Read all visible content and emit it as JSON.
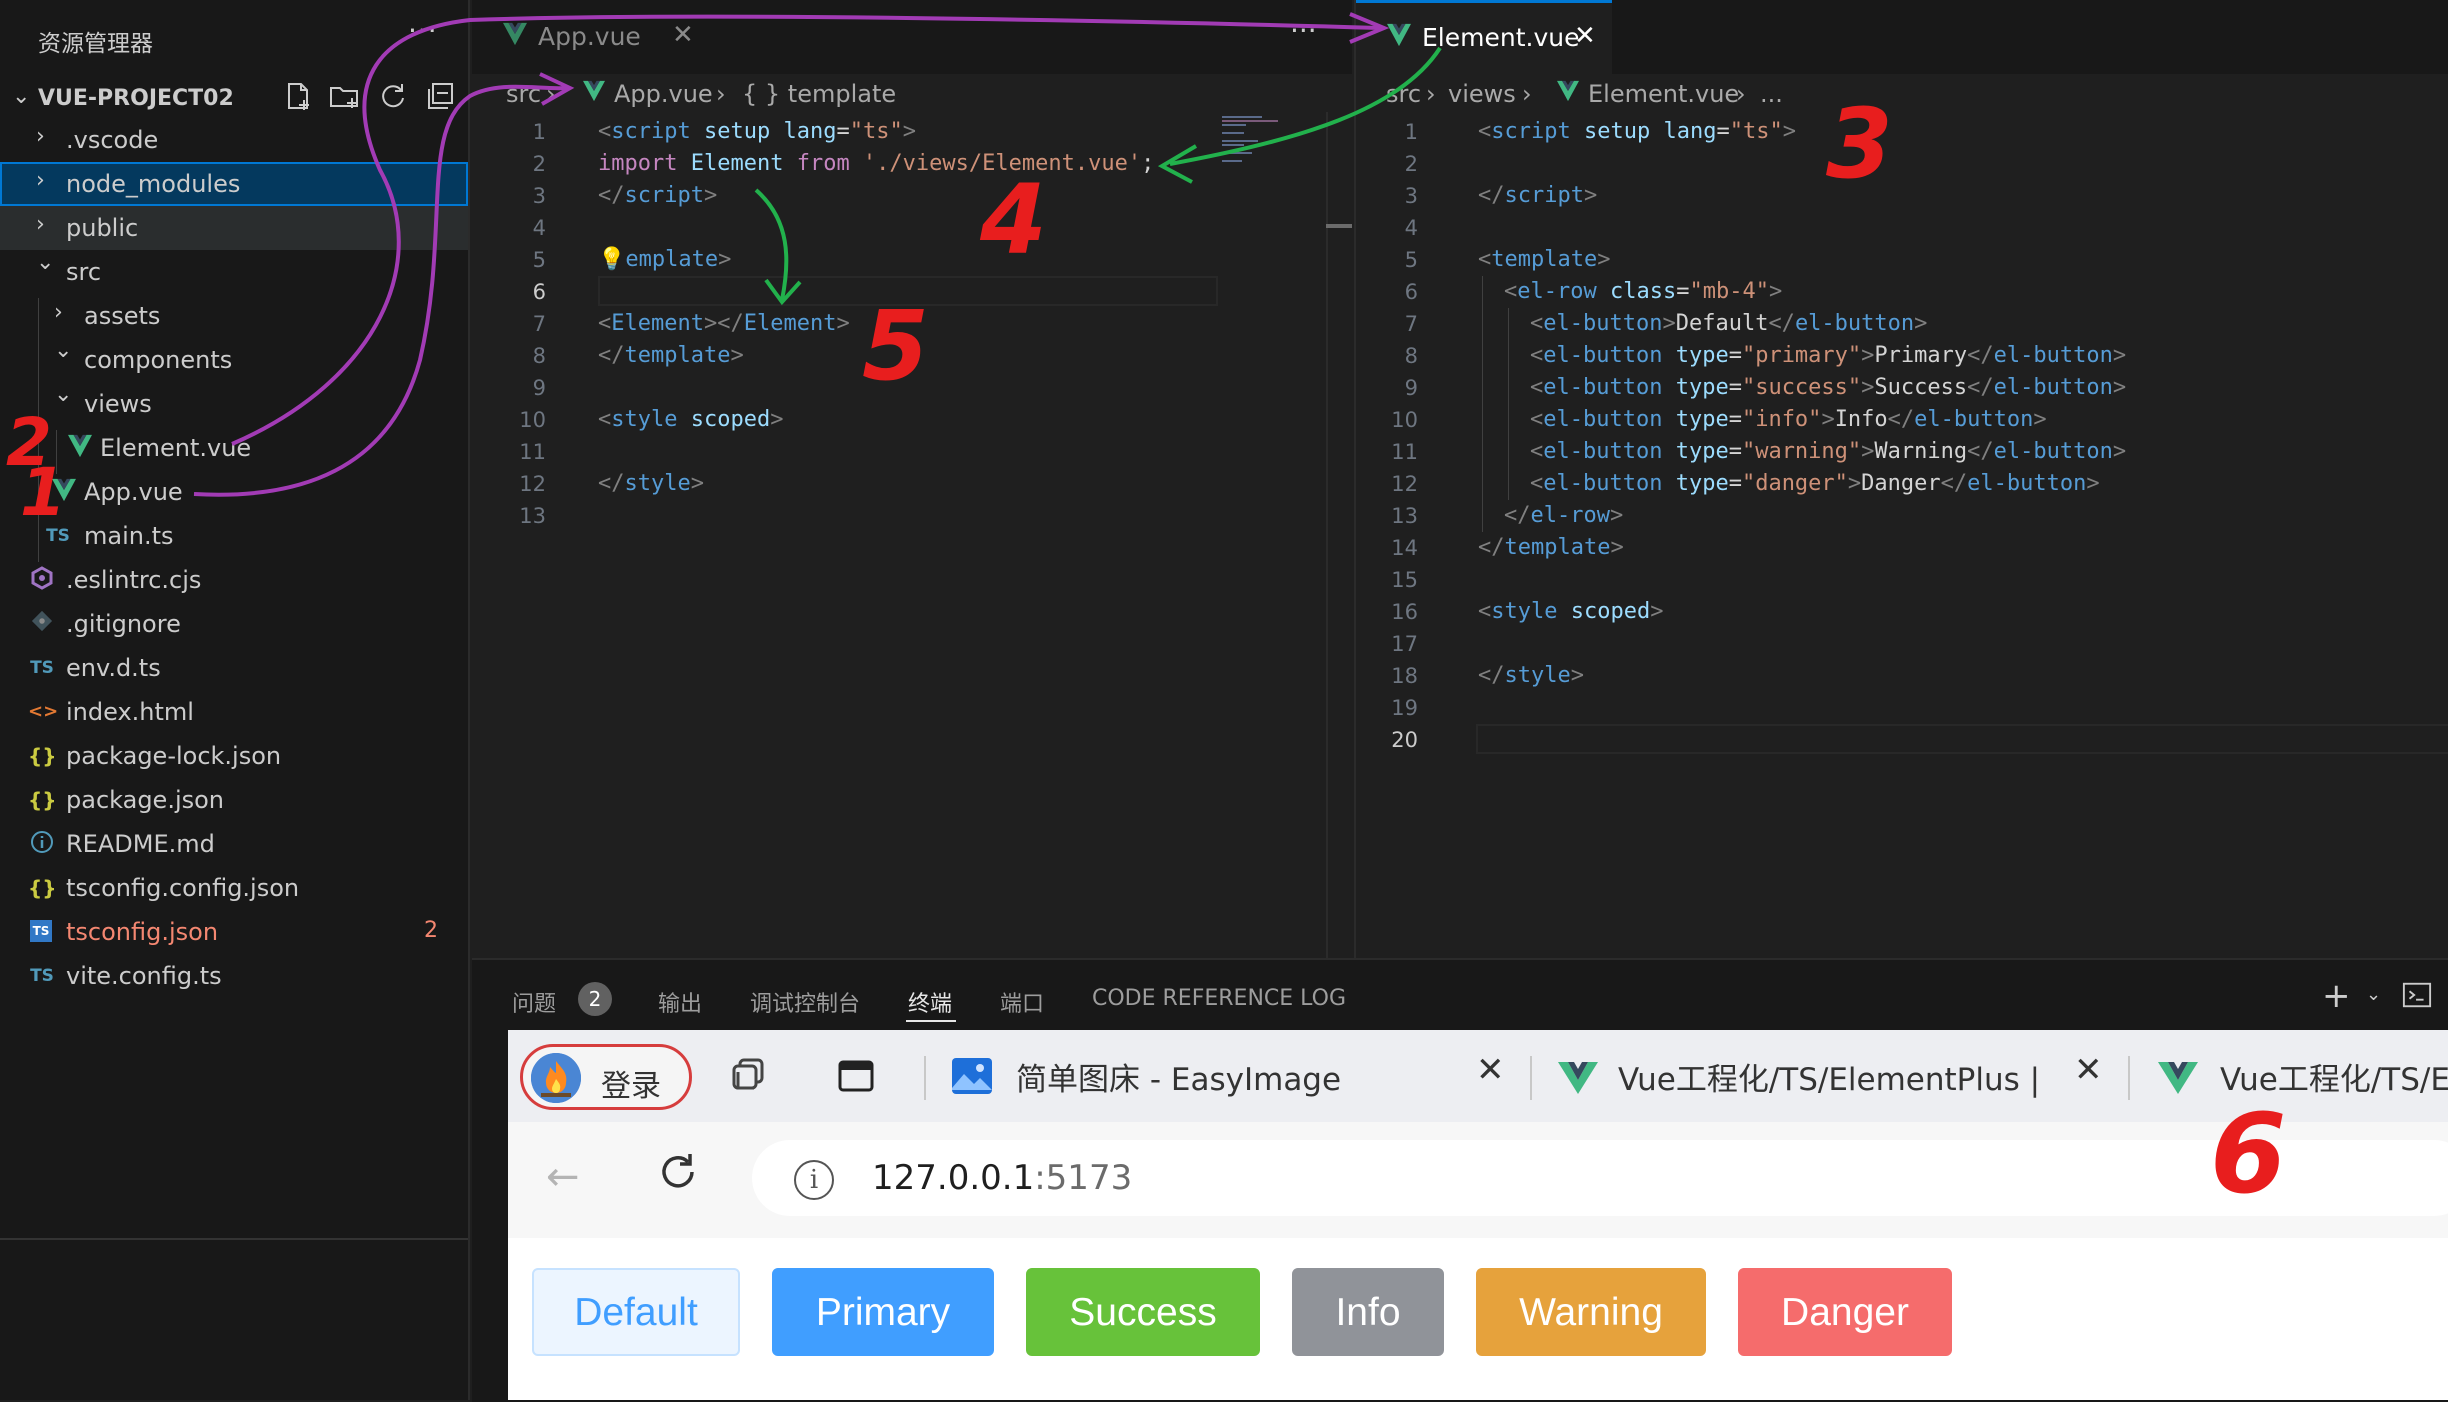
{
  "explorer": {
    "title": "资源管理器",
    "more": "···",
    "project_name": "VUE-PROJECT02",
    "items": [
      {
        "label": ".vscode",
        "icon": "",
        "chevron": "›",
        "error": false
      },
      {
        "label": "node_modules",
        "icon": "",
        "chevron": "›",
        "error": false
      },
      {
        "label": "public",
        "icon": "",
        "chevron": "›",
        "error": false
      },
      {
        "label": "src",
        "icon": "",
        "chevron": "⌄",
        "error": false
      },
      {
        "label": "assets",
        "icon": "",
        "chevron": "›",
        "error": false
      },
      {
        "label": "components",
        "icon": "",
        "chevron": "⌄",
        "error": false
      },
      {
        "label": "views",
        "icon": "",
        "chevron": "⌄",
        "error": false
      },
      {
        "label": "Element.vue",
        "icon": "vue-icon",
        "chevron": "",
        "error": false
      },
      {
        "label": "App.vue",
        "icon": "vue-icon",
        "chevron": "",
        "error": false
      },
      {
        "label": "main.ts",
        "icon": "TS",
        "chevron": "",
        "error": false
      },
      {
        "label": ".eslintrc.cjs",
        "icon": "eslint-icon",
        "chevron": "",
        "error": false
      },
      {
        "label": ".gitignore",
        "icon": "git-icon",
        "chevron": "",
        "error": false
      },
      {
        "label": "env.d.ts",
        "icon": "TS",
        "chevron": "",
        "error": false
      },
      {
        "label": "index.html",
        "icon": "<>",
        "chevron": "",
        "error": false
      },
      {
        "label": "package-lock.json",
        "icon": "{}",
        "chevron": "",
        "error": false
      },
      {
        "label": "package.json",
        "icon": "{}",
        "chevron": "",
        "error": false
      },
      {
        "label": "README.md",
        "icon": "info-icon",
        "chevron": "",
        "error": false
      },
      {
        "label": "tsconfig.config.json",
        "icon": "{}",
        "chevron": "",
        "error": false
      },
      {
        "label": "tsconfig.json",
        "icon": "TS",
        "chevron": "",
        "error": true,
        "badge": "2"
      },
      {
        "label": "vite.config.ts",
        "icon": "TS",
        "chevron": "",
        "error": false
      }
    ]
  },
  "editor_left": {
    "tab_label": "App.vue",
    "tab_close": "✕",
    "more": "···",
    "breadcrumb": [
      "src",
      "App.vue",
      "{ } template"
    ],
    "current_line": "6",
    "line_numbers": [
      "1",
      "2",
      "3",
      "4",
      "5",
      "6",
      "7",
      "8",
      "9",
      "10",
      "11",
      "12",
      "13"
    ],
    "code": {
      "l1": {
        "open": "<",
        "tag": "script",
        "a1": " setup",
        "a2": " lang",
        "eq": "=",
        "val": "\"ts\"",
        "close": ">"
      },
      "l2": {
        "kw1": "import",
        "id": " Element ",
        "kw2": "from",
        "str": " './views/Element.vue'",
        "semi": ";"
      },
      "l3": {
        "open": "</",
        "tag": "script",
        "close": ">"
      },
      "l5": {
        "tag": "emplate",
        "close": ">"
      },
      "l7": {
        "o1": "<",
        "tag1": "Element",
        "c1": "></",
        "tag2": "Element",
        "c2": ">"
      },
      "l8": {
        "open": "</",
        "tag": "template",
        "close": ">"
      },
      "l10": {
        "open": "<",
        "tag": "style",
        "attr": " scoped",
        "close": ">"
      },
      "l12": {
        "open": "</",
        "tag": "style",
        "close": ">"
      }
    }
  },
  "editor_right": {
    "tab_label": "Element.vue",
    "tab_close": "✕",
    "breadcrumb": [
      "src",
      "views",
      "Element.vue",
      "..."
    ],
    "current_line": "20",
    "line_numbers": [
      "1",
      "2",
      "3",
      "4",
      "5",
      "6",
      "7",
      "8",
      "9",
      "10",
      "11",
      "12",
      "13",
      "14",
      "15",
      "16",
      "17",
      "18",
      "19",
      "20"
    ],
    "code": {
      "l1": {
        "open": "<",
        "tag": "script",
        "a1": " setup",
        "a2": " lang",
        "eq": "=",
        "val": "\"ts\"",
        "close": ">"
      },
      "l3": {
        "open": "</",
        "tag": "script",
        "close": ">"
      },
      "l5": {
        "open": "<",
        "tag": "template",
        "close": ">"
      },
      "l6": {
        "open": "<",
        "tag": "el-row",
        "attr": " class",
        "eq": "=",
        "val": "\"mb-4\"",
        "close": ">"
      },
      "buttons": [
        {
          "type": "",
          "text": "Default"
        },
        {
          "type": "\"primary\"",
          "text": "Primary"
        },
        {
          "type": "\"success\"",
          "text": "Success"
        },
        {
          "type": "\"info\"",
          "text": "Info"
        },
        {
          "type": "\"warning\"",
          "text": "Warning"
        },
        {
          "type": "\"danger\"",
          "text": "Danger"
        }
      ],
      "btn_tag": "el-button",
      "type_attr": " type",
      "l13": {
        "open": "</",
        "tag": "el-row",
        "close": ">"
      },
      "l14": {
        "open": "</",
        "tag": "template",
        "close": ">"
      },
      "l16": {
        "open": "<",
        "tag": "style",
        "attr": " scoped",
        "close": ">"
      },
      "l18": {
        "open": "</",
        "tag": "style",
        "close": ">"
      }
    }
  },
  "panel": {
    "tabs": [
      "问题",
      "输出",
      "调试控制台",
      "终端",
      "端口",
      "CODE REFERENCE LOG"
    ],
    "problems_count": "2",
    "active_tab": "终端",
    "add": "+",
    "dropdown": "⌄"
  },
  "browser": {
    "profile_label": "登录",
    "tabs": [
      {
        "title": "简单图床 - EasyImage",
        "close": "✕"
      },
      {
        "title": "Vue工程化/TS/ElementPlus | Java",
        "close": "✕"
      },
      {
        "title": "Vue工程化/TS/Ele",
        "close": ""
      }
    ],
    "back": "←",
    "info": "i",
    "url_host": "127.0.0.1",
    "url_port": ":5173",
    "page_buttons": [
      {
        "label": "Default",
        "bg": "#ecf5ff",
        "border": "#c6e2ff",
        "color": "#409eff"
      },
      {
        "label": "Primary",
        "bg": "#409eff",
        "border": "#409eff",
        "color": "#ffffff"
      },
      {
        "label": "Success",
        "bg": "#67c23a",
        "border": "#67c23a",
        "color": "#ffffff"
      },
      {
        "label": "Info",
        "bg": "#909399",
        "border": "#909399",
        "color": "#ffffff"
      },
      {
        "label": "Warning",
        "bg": "#e6a23c",
        "border": "#e6a23c",
        "color": "#ffffff"
      },
      {
        "label": "Danger",
        "bg": "#f56c6c",
        "border": "#f56c6c",
        "color": "#ffffff"
      }
    ]
  },
  "annotations": [
    "1",
    "2",
    "3",
    "4",
    "5",
    "6"
  ],
  "colors": {
    "accent": "#0078d4",
    "vue_green": "#41b883",
    "annotation_red": "#e81e1e",
    "annotation_purple": "#a23bb5",
    "annotation_green": "#22b14c"
  }
}
